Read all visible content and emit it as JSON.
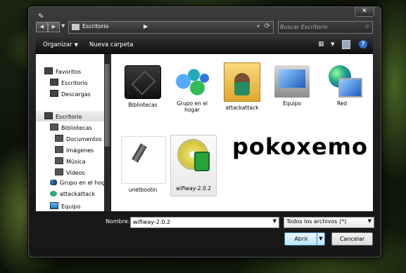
{
  "address_bar": {
    "path": [
      "Escritorio"
    ]
  },
  "search": {
    "placeholder": "Buscar Escritorio"
  },
  "toolbar": {
    "organize_label": "Organizar",
    "new_folder_label": "Nueva carpeta"
  },
  "nav_pane": {
    "items": [
      {
        "label": "Favoritos",
        "icon": "star-folder-icon"
      },
      {
        "label": "Escritorio",
        "icon": "desktop-icon"
      },
      {
        "label": "Descargas",
        "icon": "downloads-icon"
      },
      {
        "label": "Escritorio",
        "icon": "desktop-icon",
        "selected": true
      },
      {
        "label": "Bibliotecas",
        "icon": "library-icon"
      },
      {
        "label": "Documentos",
        "icon": "documents-icon"
      },
      {
        "label": "Imágenes",
        "icon": "pictures-icon"
      },
      {
        "label": "Música",
        "icon": "music-icon"
      },
      {
        "label": "Vídeos",
        "icon": "videos-icon"
      },
      {
        "label": "Grupo en el hogar",
        "icon": "homegroup-icon"
      },
      {
        "label": "attackattack",
        "icon": "user-icon"
      },
      {
        "label": "Equipo",
        "icon": "computer-icon"
      }
    ]
  },
  "content": {
    "items": [
      {
        "label": "Bibliotecas",
        "icon": "libraries-icon"
      },
      {
        "label": "Grupo en el hogar",
        "icon": "homegroup-icon"
      },
      {
        "label": "attackattack",
        "icon": "user-folder-icon"
      },
      {
        "label": "Equipo",
        "icon": "computer-icon"
      },
      {
        "label": "Red",
        "icon": "network-icon"
      },
      {
        "label": "unetbootin",
        "icon": "usb-icon"
      },
      {
        "label": "wifiway-2.0.2",
        "icon": "disc-image-icon",
        "selected": true
      }
    ],
    "overlay_text": "pokoxemo"
  },
  "footer": {
    "name_label": "Nombre:",
    "file_name": "wifiway-2.0.2",
    "file_type": "Todos los archivos (*)",
    "open_label": "Abrir",
    "cancel_label": "Cancelar"
  },
  "colors": {
    "accent": "#3c7fb1",
    "chrome": "#1e1e1e"
  }
}
